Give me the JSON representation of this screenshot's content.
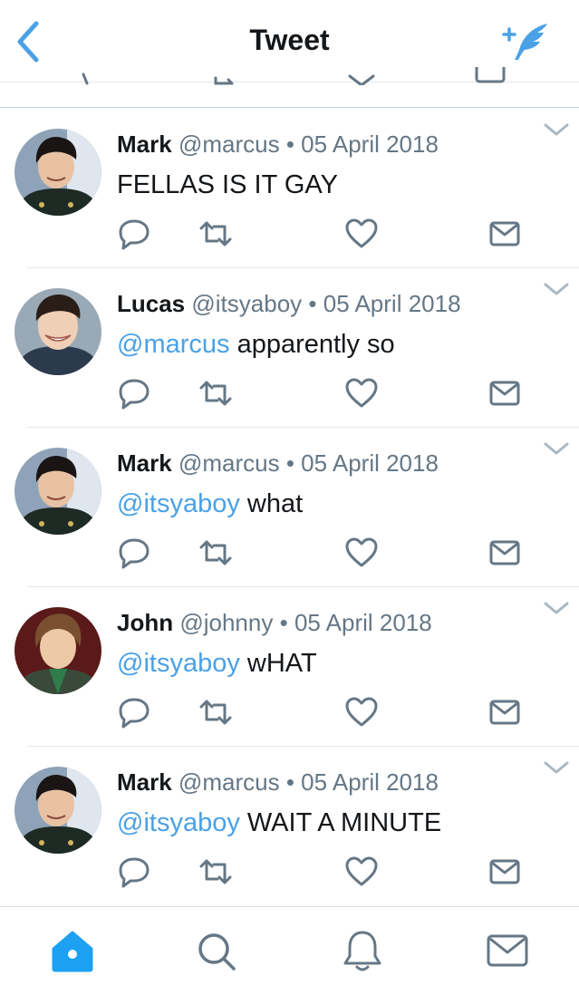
{
  "header": {
    "title": "Tweet",
    "back_icon": "chevron-left-icon",
    "compose_icon": "compose-feather-icon",
    "accent_color": "#4aa1e6"
  },
  "tweets": [
    {
      "name": "Mark",
      "handle": "@marcus",
      "separator": "•",
      "date": "05 April 2018",
      "mention": "",
      "text": "FELLAS IS IT GAY"
    },
    {
      "name": "Lucas",
      "handle": "@itsyaboy",
      "separator": "•",
      "date": "05 April 2018",
      "mention": "@marcus",
      "text": " apparently so"
    },
    {
      "name": "Mark",
      "handle": "@marcus",
      "separator": "•",
      "date": "05 April 2018",
      "mention": "@itsyaboy",
      "text": " what"
    },
    {
      "name": "John",
      "handle": "@johnny",
      "separator": "•",
      "date": "05 April 2018",
      "mention": "@itsyaboy",
      "text": " wHAT"
    },
    {
      "name": "Mark",
      "handle": "@marcus",
      "separator": "•",
      "date": "05 April 2018",
      "mention": "@itsyaboy",
      "text": " WAIT A MINUTE"
    }
  ],
  "tweet_actions": [
    "reply-icon",
    "retweet-icon",
    "like-heart-icon",
    "direct-message-icon"
  ],
  "tabbar": {
    "items": [
      "home-icon",
      "search-icon",
      "notifications-bell-icon",
      "messages-envelope-icon"
    ],
    "active": "home-icon",
    "active_color": "#1da1f2",
    "inactive_color": "#657786"
  }
}
